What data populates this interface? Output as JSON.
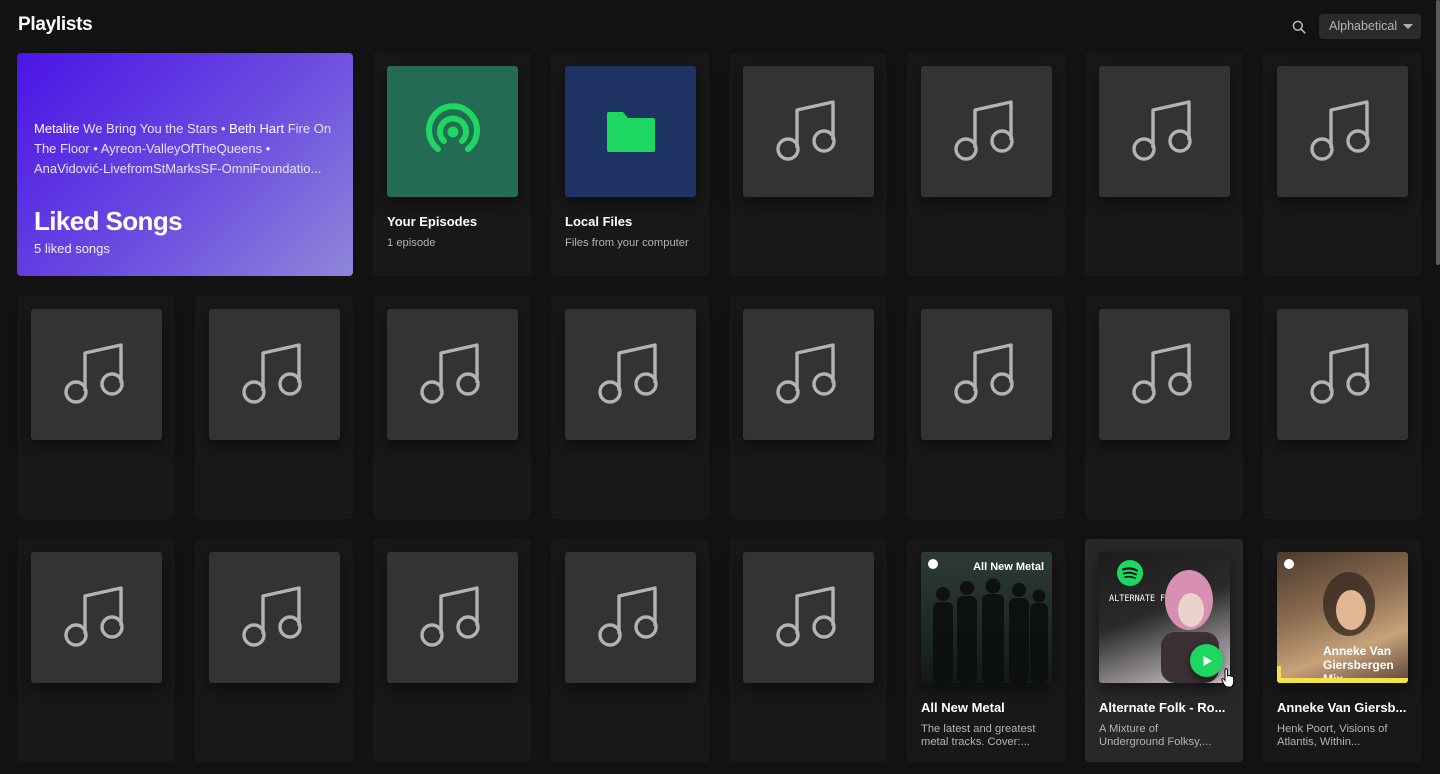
{
  "header": {
    "title": "Playlists",
    "sort": {
      "selected": "Alphabetical"
    }
  },
  "liked_songs": {
    "title": "Liked Songs",
    "count": "5 liked songs",
    "preview": [
      {
        "artist": "Metalite",
        "song": "We Bring You the Stars"
      },
      {
        "artist": "Beth Hart",
        "song": "Fire On The Floor"
      },
      {
        "artist": "",
        "song": "Ayreon-ValleyOfTheQueens"
      },
      {
        "artist": "",
        "song": "AnaVidović-LivefromStMarksSF-OmniFoundatio..."
      }
    ],
    "separator": "•"
  },
  "cards": {
    "episodes": {
      "title": "Your Episodes",
      "subtitle": "1 episode"
    },
    "local_files": {
      "title": "Local Files",
      "subtitle": "Files from your computer"
    },
    "all_new_metal": {
      "title": "All New Metal",
      "subtitle": "The latest and greatest metal tracks. Cover:...",
      "cover_text": "All New Metal"
    },
    "alternate_folk": {
      "title": "Alternate Folk - Ro...",
      "subtitle": "A Mixture of Underground Folksy,...",
      "cover_text": "ALTERNATE FOLK"
    },
    "anneke": {
      "title": "Anneke Van Giersb...",
      "subtitle": "Henk Poort, Visions of Atlantis, Within...",
      "cover_text": "Anneke Van Giersbergen Mix"
    }
  },
  "icons": {
    "search": "search-icon",
    "episodes": "podcast-icon",
    "local_files": "folder-icon",
    "placeholder": "music-note-icon",
    "play": "play-icon"
  },
  "colors": {
    "accent": "#1ed760",
    "background": "#121212",
    "card": "#181818"
  }
}
